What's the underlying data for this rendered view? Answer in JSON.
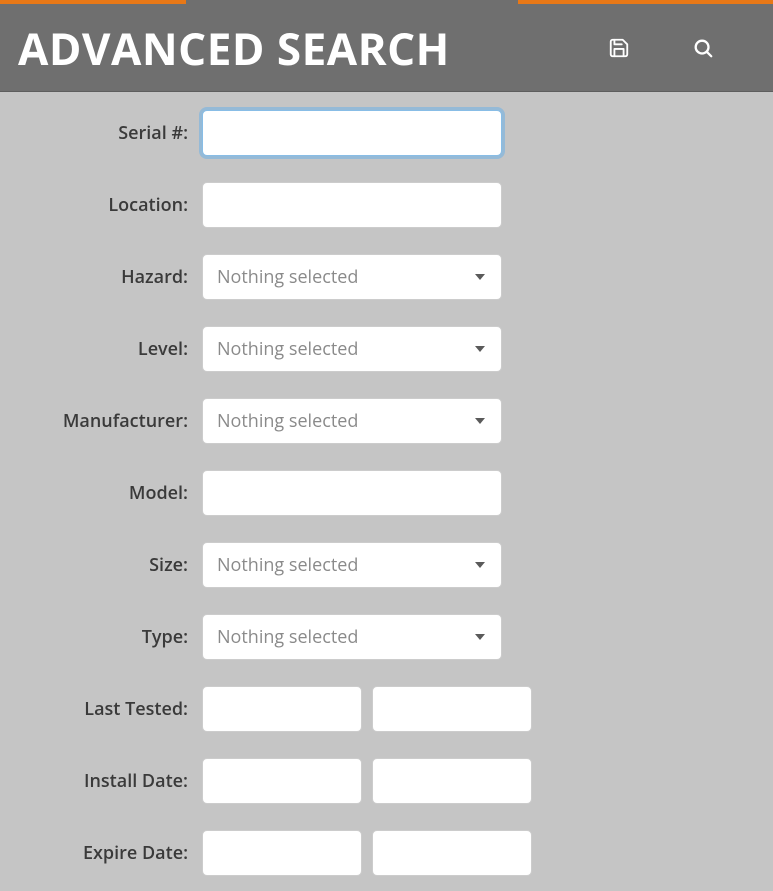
{
  "header": {
    "title": "ADVANCED SEARCH"
  },
  "form": {
    "serial": {
      "label": "Serial #:",
      "value": ""
    },
    "location": {
      "label": "Location:",
      "value": ""
    },
    "hazard": {
      "label": "Hazard:",
      "selected": "Nothing selected"
    },
    "level": {
      "label": "Level:",
      "selected": "Nothing selected"
    },
    "manufacturer": {
      "label": "Manufacturer:",
      "selected": "Nothing selected"
    },
    "model": {
      "label": "Model:",
      "value": ""
    },
    "size": {
      "label": "Size:",
      "selected": "Nothing selected"
    },
    "type": {
      "label": "Type:",
      "selected": "Nothing selected"
    },
    "last_tested": {
      "label": "Last Tested:",
      "from": "",
      "to": ""
    },
    "install_date": {
      "label": "Install Date:",
      "from": "",
      "to": ""
    },
    "expire_date": {
      "label": "Expire Date:",
      "from": "",
      "to": ""
    }
  }
}
